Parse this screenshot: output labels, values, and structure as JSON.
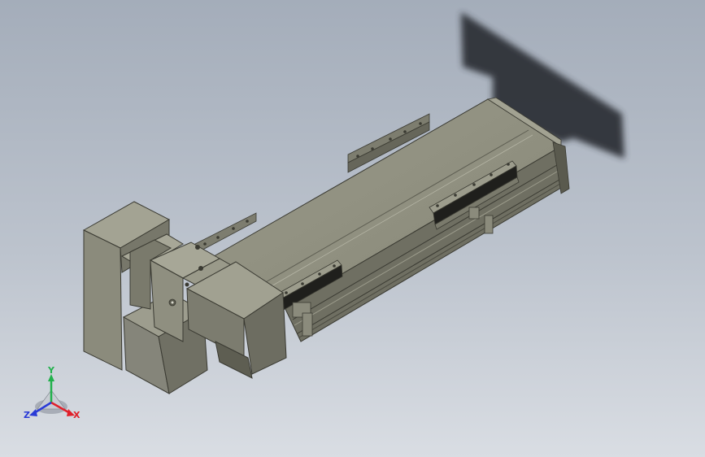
{
  "viewport": {
    "background_top": "#a4adba",
    "background_bottom": "#d9dde3"
  },
  "model": {
    "description_icon": "linear-actuator-motor-module",
    "body_color": "#8a8a7c",
    "body_dark": "#5e5e52",
    "body_light": "#a7a797",
    "shadow_color": "#2f3238"
  },
  "triad": {
    "y_label": "Y",
    "x_label": "X",
    "z_label": "Z",
    "y_color": "#22b14c",
    "x_color": "#e0202a",
    "z_color": "#2a3bd6"
  }
}
